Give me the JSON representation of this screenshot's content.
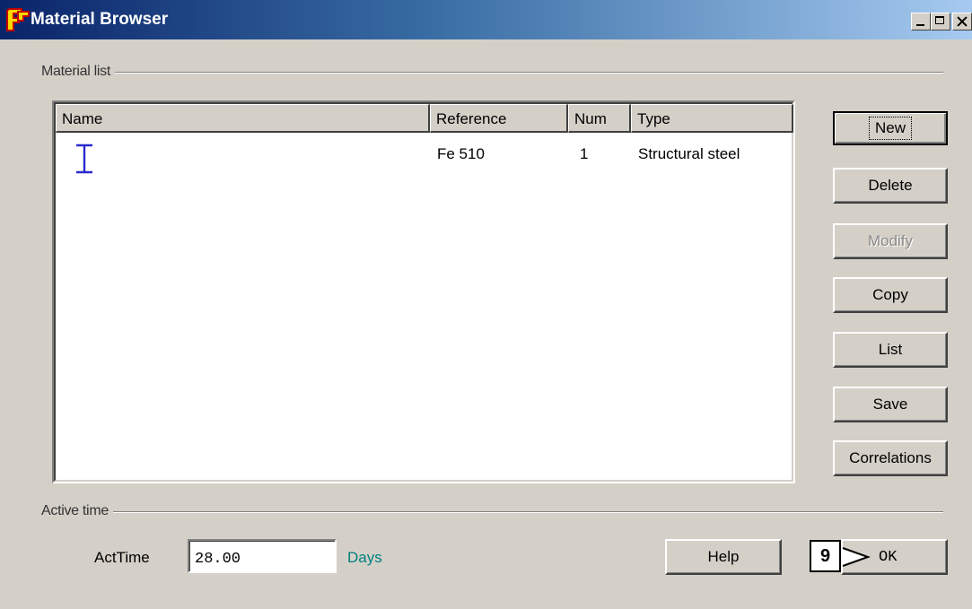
{
  "window": {
    "title": "Material Browser",
    "icon": "app-logo-icon",
    "controls": [
      "minimize-icon",
      "maximize-icon",
      "close-icon"
    ]
  },
  "material_list": {
    "group_label": "Material list",
    "columns": [
      "Name",
      "Reference",
      "Num",
      "Type"
    ],
    "rows": [
      {
        "name_icon": "i-beam-section-icon",
        "reference": "Fe 510",
        "num": "1",
        "type": "Structural steel"
      }
    ]
  },
  "side_buttons": {
    "new": "New",
    "delete": "Delete",
    "modify": "Modify",
    "copy": "Copy",
    "list": "List",
    "save": "Save",
    "correlations": "Correlations"
  },
  "active_time": {
    "group_label": "Active time",
    "field_label": "ActTime",
    "value": "28.00",
    "unit": "Days"
  },
  "footer": {
    "help": "Help",
    "step_badge": "9",
    "ok": "OK"
  },
  "colors": {
    "title_gradient_start": "#0a246a",
    "title_gradient_end": "#a6caf0",
    "unit_text": "#008080",
    "i_beam_icon": "#2a2ad0"
  }
}
